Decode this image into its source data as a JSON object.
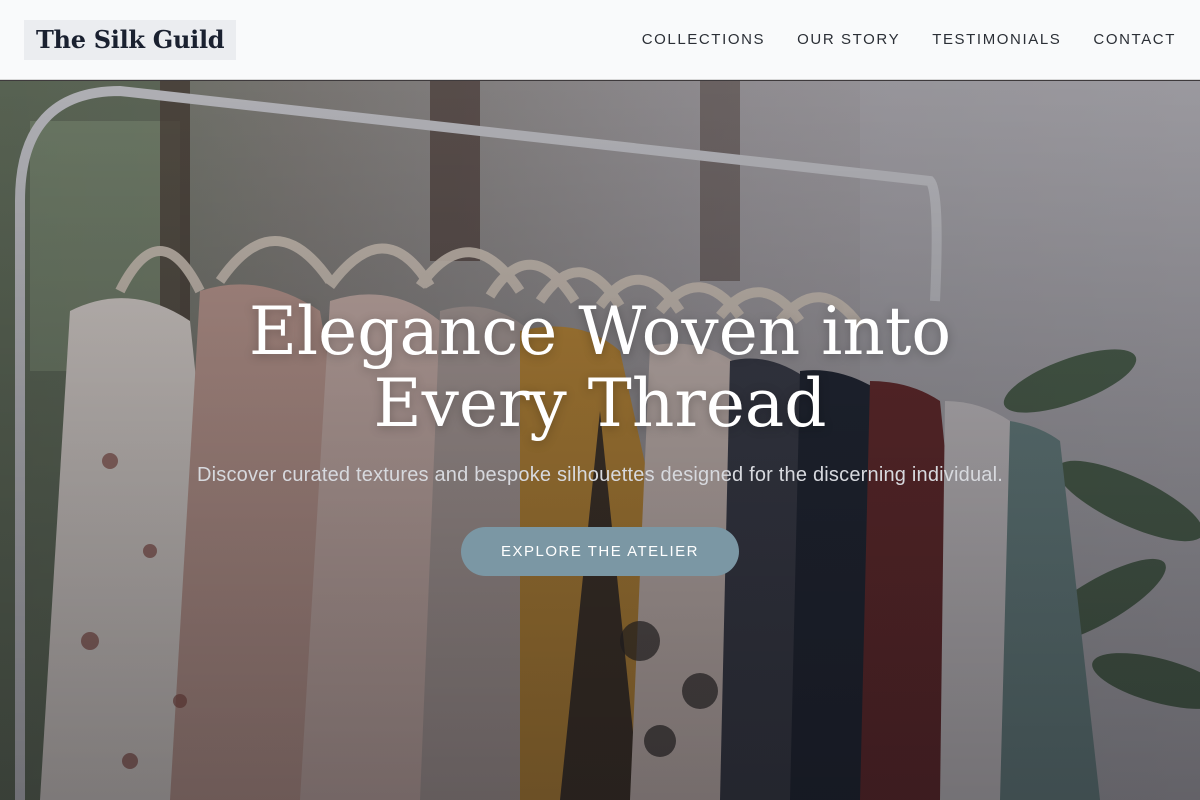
{
  "brand": {
    "name": "The Silk Guild"
  },
  "nav": {
    "items": [
      {
        "label": "COLLECTIONS"
      },
      {
        "label": "OUR STORY"
      },
      {
        "label": "TESTIMONIALS"
      },
      {
        "label": "CONTACT"
      }
    ]
  },
  "hero": {
    "title": "Elegance Woven into Every Thread",
    "subtitle": "Discover curated textures and bespoke silhouettes designed for the discerning individual.",
    "cta_label": "EXPLORE THE ATELIER"
  },
  "colors": {
    "header_bg": "#f9fafb",
    "logo_bg": "#ebedf0",
    "brand_text": "#1a2130",
    "cta_bg": "#7b97a4"
  }
}
